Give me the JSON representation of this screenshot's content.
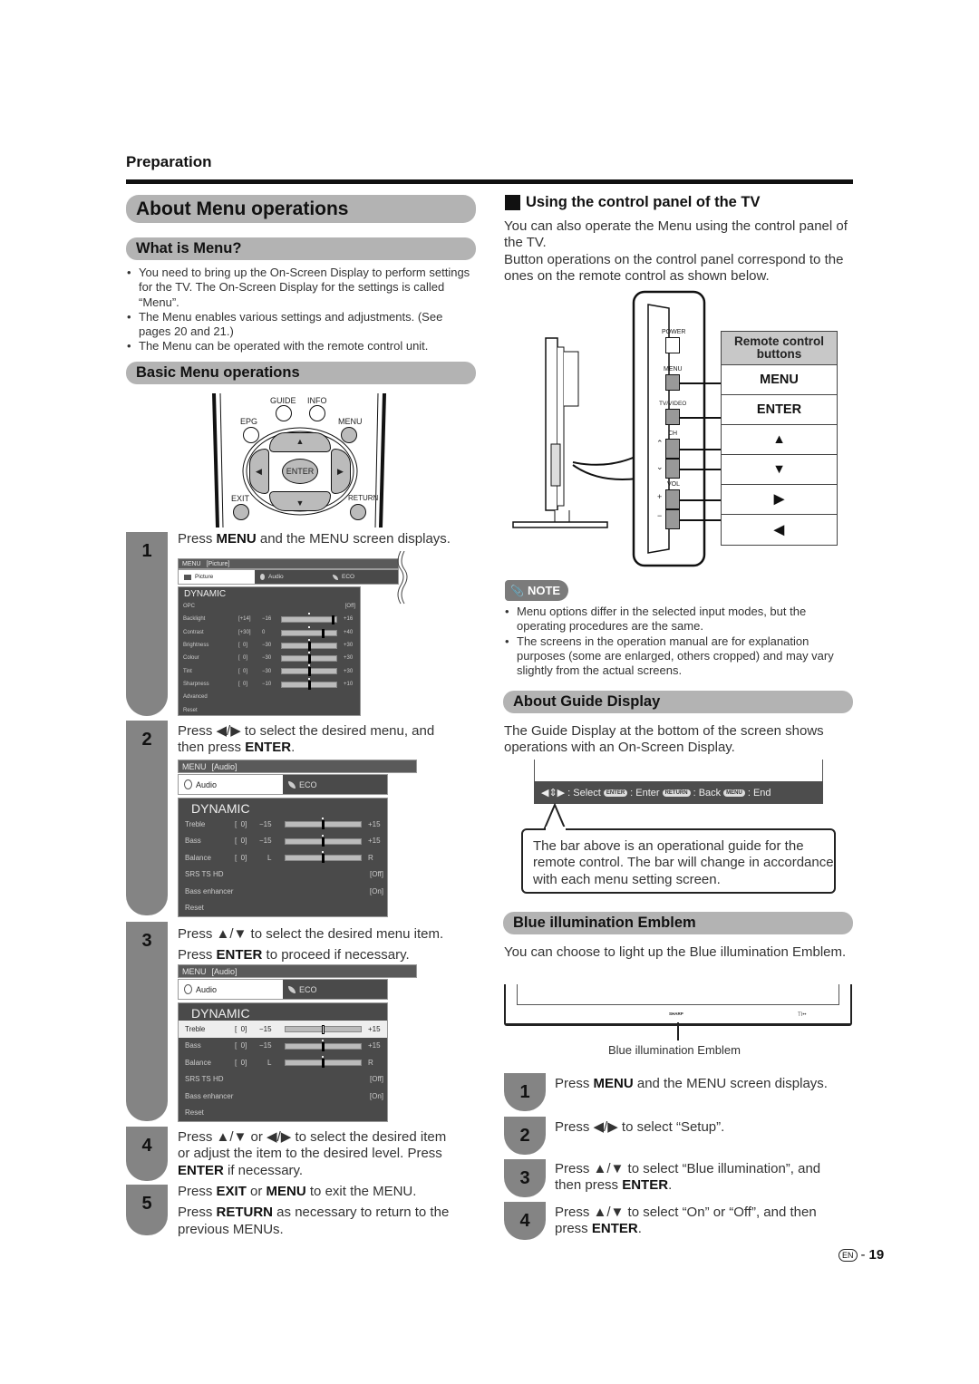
{
  "header": {
    "section": "Preparation",
    "title": "About Menu operations"
  },
  "what_is_menu": {
    "heading": "What is Menu?",
    "bullets": [
      "You need to bring up the On-Screen Display to perform settings for the TV. The On-Screen Display for the settings is called “Menu”.",
      "The Menu enables various settings and adjustments. (See pages 20 and 21.)",
      "The Menu can be operated with the remote control unit."
    ]
  },
  "basic_ops": {
    "heading": "Basic Menu operations",
    "remote": {
      "guide": "GUIDE",
      "info": "INFO",
      "epg": "EPG",
      "menu": "MENU",
      "enter": "ENTER",
      "exit": "EXIT",
      "return": "RETURN"
    },
    "steps": [
      {
        "num": "1",
        "text_pre": "Press ",
        "bold1": "MENU",
        "text_post": " and the MENU screen displays."
      },
      {
        "num": "2",
        "line1": "Press ◀/▶ to select the desired menu, and",
        "line2_pre": "then press ",
        "line2_bold": "ENTER",
        "line2_post": "."
      },
      {
        "num": "3",
        "line1": "Press ▲/▼ to select the desired menu item.",
        "line2_pre": "Press ",
        "line2_bold": "ENTER",
        "line2_post": " to proceed if necessary."
      },
      {
        "num": "4",
        "line1": "Press ▲/▼ or ◀/▶ to select the desired item",
        "line2": "or adjust the item to the desired level. Press",
        "line3_bold": "ENTER",
        "line3_post": " if necessary."
      },
      {
        "num": "5",
        "l1_pre": "Press ",
        "l1_b1": "EXIT",
        "l1_mid": " or ",
        "l1_b2": "MENU",
        "l1_post": " to exit the MENU.",
        "l2_pre": "Press ",
        "l2_b": "RETURN",
        "l2_post": " as necessary to return to the",
        "l3": "previous MENUs."
      }
    ]
  },
  "osd_picture": {
    "menu": "MENU",
    "context": "[Picture]",
    "tabs": [
      "Picture",
      "Audio",
      "ECO"
    ],
    "mode": "DYNAMIC",
    "rows": [
      {
        "label": "OPC",
        "value": "[Off]"
      },
      {
        "label": "Backlight",
        "bracket": "[+14]",
        "min": "−16",
        "max": "+16",
        "level": 0.94
      },
      {
        "label": "Contrast",
        "bracket": "[+30]",
        "min": "0",
        "max": "+40",
        "level": 0.75
      },
      {
        "label": "Brightness",
        "bracket": "[  0]",
        "min": "−30",
        "max": "+30",
        "level": 0.5
      },
      {
        "label": "Colour",
        "bracket": "[  0]",
        "min": "−30",
        "max": "+30",
        "level": 0.5
      },
      {
        "label": "Tint",
        "bracket": "[  0]",
        "min": "−30",
        "max": "+30",
        "level": 0.5
      },
      {
        "label": "Sharpness",
        "bracket": "[  0]",
        "min": "−10",
        "max": "+10",
        "level": 0.5
      },
      {
        "label": "Advanced"
      },
      {
        "label": "Reset"
      }
    ]
  },
  "osd_audio": {
    "menu": "MENU",
    "context": "[Audio]",
    "tabs": [
      "Audio",
      "ECO"
    ],
    "mode": "DYNAMIC",
    "rows": [
      {
        "label": "Treble",
        "bracket": "[  0]",
        "min": "−15",
        "max": "+15",
        "level": 0.5
      },
      {
        "label": "Bass",
        "bracket": "[  0]",
        "min": "−15",
        "max": "+15",
        "level": 0.5
      },
      {
        "label": "Balance",
        "bracket": "[  0]",
        "min": "L",
        "max": "R",
        "level": 0.5
      },
      {
        "label": "SRS TS HD",
        "value": "[Off]"
      },
      {
        "label": "Bass enhancer",
        "value": "[On]"
      },
      {
        "label": "Reset"
      }
    ]
  },
  "control_panel": {
    "heading": "Using the control panel of the TV",
    "para1": "You can also operate the Menu using the control panel of the TV.",
    "para2": "Button operations on the control panel correspond to the ones on the remote control as shown below.",
    "panel_labels": [
      "POWER",
      "MENU",
      "TV/VIDEO",
      "CH",
      "VOL",
      "+",
      "−"
    ],
    "table_header": "Remote control buttons",
    "table_rows": [
      "MENU",
      "ENTER",
      "▲",
      "▼",
      "▶",
      "◀"
    ]
  },
  "note": {
    "badge": "NOTE",
    "bullets": [
      "Menu options differ in the selected input modes, but the operating procedures are the same.",
      "The screens in the operation manual are for explanation purposes (some are enlarged, others cropped) and may vary slightly from the actual screens."
    ]
  },
  "guide_display": {
    "heading": "About Guide Display",
    "para": "The Guide Display at the bottom of the screen shows operations with an On-Screen Display.",
    "bar": {
      "select": ": Select",
      "enter_key": "ENTER",
      "enter": ": Enter",
      "return_key": "RETURN",
      "back": ": Back",
      "menu_key": "MENU",
      "end": ": End"
    },
    "callout": "The bar above is an operational guide for the remote control. The bar will change in accordance with each menu setting screen."
  },
  "emblem": {
    "heading": "Blue illumination Emblem",
    "para": "You can choose to light up the Blue illumination Emblem.",
    "logo": "SHARP",
    "caption": "Blue illumination Emblem",
    "steps": [
      {
        "num": "1",
        "pre": "Press ",
        "bold": "MENU",
        "post": " and the MENU screen displays."
      },
      {
        "num": "2",
        "line1": "Press ◀/▶ to select “Setup”."
      },
      {
        "num": "3",
        "line1": "Press ▲/▼ to select “Blue illumination”, and",
        "l2_pre": "then press ",
        "l2_bold": "ENTER",
        "l2_post": "."
      },
      {
        "num": "4",
        "line1": "Press ▲/▼ to select “On” or “Off”, and then",
        "l2_pre": "press ",
        "l2_bold": "ENTER",
        "l2_post": "."
      }
    ]
  },
  "footer": {
    "lang": "EN",
    "sep": "-",
    "page": "19"
  }
}
